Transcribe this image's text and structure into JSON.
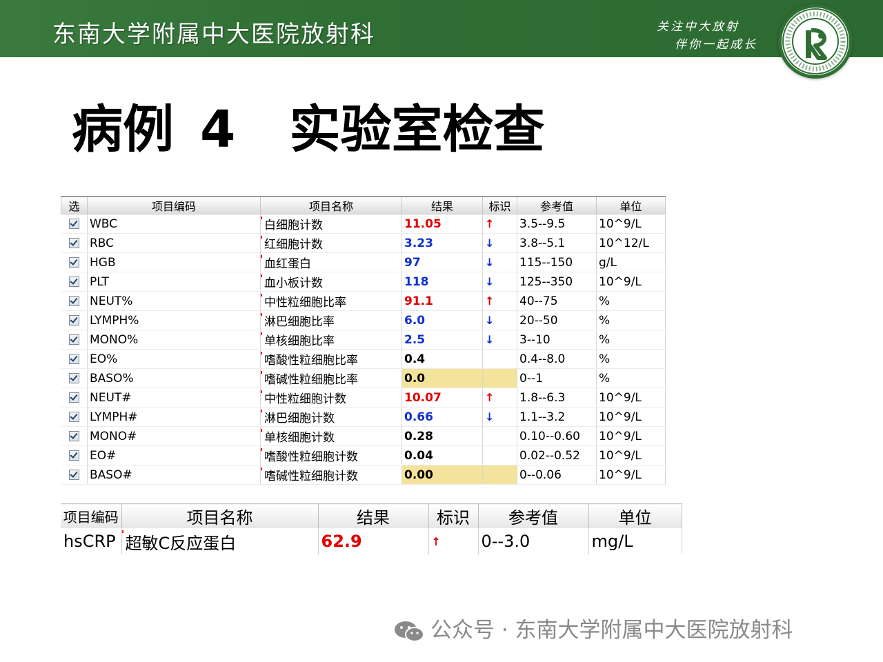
{
  "banner": {
    "title": "东南大学附属中大医院放射科",
    "slogan_line1": "关注中大放射",
    "slogan_line2": "伴你一起成长",
    "logo_ring_text": "东南大学附属中大医院 · DEPARTMENT OF RADIOLOGY ZHONGDA HOSPITAL",
    "logo_letter": "R",
    "brand_color": "#2f6f34"
  },
  "heading": {
    "case": "病例",
    "number": "4",
    "topic": "实验室检查"
  },
  "lab_table": {
    "headers": [
      "选",
      "项目编码",
      "项目名称",
      "结果",
      "标识",
      "参考值",
      "单位"
    ],
    "rows": [
      {
        "code": "WBC",
        "name": "白细胞计数",
        "result": "11.05",
        "flag": "↑",
        "ref": "3.5--9.5",
        "unit": "10^9/L",
        "color": "red"
      },
      {
        "code": "RBC",
        "name": "红细胞计数",
        "result": "3.23",
        "flag": "↓",
        "ref": "3.8--5.1",
        "unit": "10^12/L",
        "color": "blue"
      },
      {
        "code": "HGB",
        "name": "血红蛋白",
        "result": "97",
        "flag": "↓",
        "ref": "115--150",
        "unit": "g/L",
        "color": "blue"
      },
      {
        "code": "PLT",
        "name": "血小板计数",
        "result": "118",
        "flag": "↓",
        "ref": "125--350",
        "unit": "10^9/L",
        "color": "blue"
      },
      {
        "code": "NEUT%",
        "name": "中性粒细胞比率",
        "result": "91.1",
        "flag": "↑",
        "ref": "40--75",
        "unit": "%",
        "color": "red"
      },
      {
        "code": "LYMPH%",
        "name": "淋巴细胞比率",
        "result": "6.0",
        "flag": "↓",
        "ref": "20--50",
        "unit": "%",
        "color": "blue"
      },
      {
        "code": "MONO%",
        "name": "单核细胞比率",
        "result": "2.5",
        "flag": "↓",
        "ref": "3--10",
        "unit": "%",
        "color": "blue"
      },
      {
        "code": "EO%",
        "name": "嗜酸性粒细胞比率",
        "result": "0.4",
        "flag": "",
        "ref": "0.4--8.0",
        "unit": "%",
        "color": "normal"
      },
      {
        "code": "BASO%",
        "name": "嗜碱性粒细胞比率",
        "result": "0.0",
        "flag": "",
        "ref": "0--1",
        "unit": "%",
        "color": "highlight"
      },
      {
        "code": "NEUT#",
        "name": "中性粒细胞计数",
        "result": "10.07",
        "flag": "↑",
        "ref": "1.8--6.3",
        "unit": "10^9/L",
        "color": "red"
      },
      {
        "code": "LYMPH#",
        "name": "淋巴细胞计数",
        "result": "0.66",
        "flag": "↓",
        "ref": "1.1--3.2",
        "unit": "10^9/L",
        "color": "blue"
      },
      {
        "code": "MONO#",
        "name": "单核细胞计数",
        "result": "0.28",
        "flag": "",
        "ref": "0.10--0.60",
        "unit": "10^9/L",
        "color": "normal"
      },
      {
        "code": "EO#",
        "name": "嗜酸性粒细胞计数",
        "result": "0.04",
        "flag": "",
        "ref": "0.02--0.52",
        "unit": "10^9/L",
        "color": "normal"
      },
      {
        "code": "BASO#",
        "name": "嗜碱性粒细胞计数",
        "result": "0.00",
        "flag": "",
        "ref": "0--0.06",
        "unit": "10^9/L",
        "color": "highlight"
      }
    ]
  },
  "crp_table": {
    "headers": [
      "项目编码",
      "项目名称",
      "结果",
      "标识",
      "参考值",
      "单位"
    ],
    "row": {
      "code": "hsCRP",
      "name": "超敏C反应蛋白",
      "result": "62.9",
      "flag": "↑",
      "ref": "0--3.0",
      "unit": "mg/L"
    }
  },
  "footer": {
    "text": "公众号 · 东南大学附属中大医院放射科"
  }
}
